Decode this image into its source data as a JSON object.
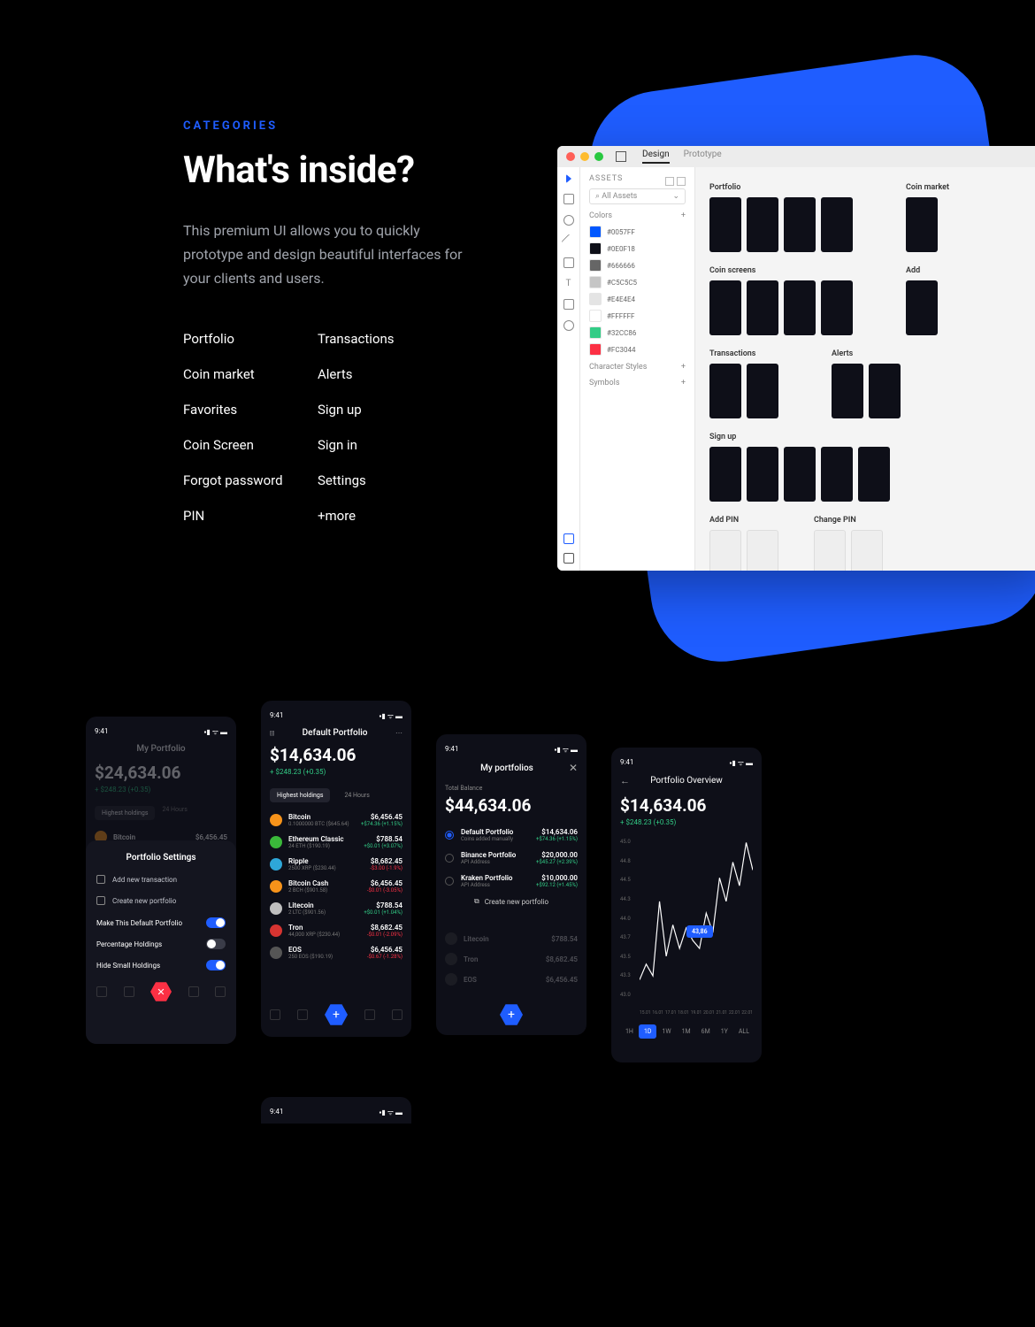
{
  "hero": {
    "eyebrow": "CATEGORIES",
    "headline": "What's inside?",
    "description": "This premium UI allows you to quickly prototype and design beautiful interfaces for your clients and users.",
    "categories_col1": [
      "Portfolio",
      "Coin market",
      "Favorites",
      "Coin Screen",
      "Forgot password",
      "PIN"
    ],
    "categories_col2": [
      "Transactions",
      "Alerts",
      "Sign up",
      "Sign in",
      "Settings",
      "+more"
    ]
  },
  "app": {
    "tabs": [
      "Design",
      "Prototype"
    ],
    "assets_label": "ASSETS",
    "search": "All Assets",
    "sections": {
      "colors": "Colors",
      "char_styles": "Character Styles",
      "symbols": "Symbols"
    },
    "swatches": [
      {
        "hex": "#0057FF"
      },
      {
        "hex": "#0E0F18"
      },
      {
        "hex": "#666666"
      },
      {
        "hex": "#C5C5C5"
      },
      {
        "hex": "#E4E4E4"
      },
      {
        "hex": "#FFFFFF"
      },
      {
        "hex": "#32CC86"
      },
      {
        "hex": "#FC3044"
      }
    ],
    "canvas_sections": [
      "Portfolio",
      "Coin market",
      "Coin screens",
      "Add",
      "Transactions",
      "Alerts",
      "Sign up",
      "Add PIN",
      "Change PIN"
    ]
  },
  "common": {
    "time": "9:41"
  },
  "phone1": {
    "title": "My Portfolio",
    "balance": "$24,634.06",
    "delta": "+ $248.23 (+0.35)",
    "tabs": [
      "Highest holdings",
      "24 Hours"
    ],
    "coin": "Bitcoin",
    "coin_val": "$6,456.45",
    "sheet": {
      "title": "Portfolio Settings",
      "add_tx": "Add new transaction",
      "create_pf": "Create new portfolio",
      "opt1": "Make This Default Portfolio",
      "opt2": "Percentage Holdings",
      "opt3": "Hide Small Holdings"
    }
  },
  "phone2": {
    "title": "Default Portfolio",
    "balance": "$14,634.06",
    "delta": "+ $248.23 (+0.35)",
    "tabs": [
      "Highest holdings",
      "24 Hours"
    ],
    "coins": [
      {
        "name": "Bitcoin",
        "sub": "0.1000000 BTC ($645.64)",
        "val": "$6,456.45",
        "chg": "+$74.36 (+1.15%)",
        "pos": true,
        "color": "#f7931a"
      },
      {
        "name": "Ethereum Classic",
        "sub": "24 ETH ($190.19)",
        "val": "$788.54",
        "chg": "+$0.01 (+3.07%)",
        "pos": true,
        "color": "#3ab83a"
      },
      {
        "name": "Ripple",
        "sub": "2500 XRP ($230.44)",
        "val": "$8,682.45",
        "chg": "-$3.00 (-1.9%)",
        "pos": false,
        "color": "#2ea7d8"
      },
      {
        "name": "Bitcoin Cash",
        "sub": "2 BCH ($901.58)",
        "val": "$6,456.45",
        "chg": "-$0.01 (-3.05%)",
        "pos": false,
        "color": "#f7931a"
      },
      {
        "name": "Litecoin",
        "sub": "2 LTC ($901.56)",
        "val": "$788.54",
        "chg": "+$0.01 (+1.04%)",
        "pos": true,
        "color": "#bfbfbf"
      },
      {
        "name": "Tron",
        "sub": "44,000 XRP ($230.44)",
        "val": "$8,682.45",
        "chg": "-$0.01 (-2.09%)",
        "pos": false,
        "color": "#d63431"
      },
      {
        "name": "EOS",
        "sub": "250 EOS ($190.19)",
        "val": "$6,456.45",
        "chg": "-$0.67 (-1.28%)",
        "pos": false,
        "color": "#555"
      }
    ]
  },
  "phone3": {
    "title": "My portfolios",
    "total_label": "Total Balance",
    "total": "$44,634.06",
    "portfolios": [
      {
        "name": "Default Portfolio",
        "sub": "Coins added manually",
        "val": "$14,634.06",
        "chg": "+$74.36 (+1.15%)",
        "on": true
      },
      {
        "name": "Binance Portfolio",
        "sub": "API Address",
        "val": "$20,000.00",
        "chg": "+$45.27 (+2.39%)",
        "on": false
      },
      {
        "name": "Kraken Portfolio",
        "sub": "API Address",
        "val": "$10,000.00",
        "chg": "+$92.12 (+1.45%)",
        "on": false
      }
    ],
    "create": "Create new portfolio",
    "faded": [
      {
        "name": "Litecoin",
        "val": "$788.54"
      },
      {
        "name": "Tron",
        "val": "$8,682.45"
      },
      {
        "name": "EOS",
        "val": "$6,456.45"
      }
    ]
  },
  "phone4": {
    "title": "Portfolio Overview",
    "balance": "$14,634.06",
    "delta": "+ $248.23 (+0.35)",
    "bubble": "43,86",
    "ranges": [
      "1H",
      "1D",
      "1W",
      "1M",
      "6M",
      "1Y",
      "ALL"
    ]
  },
  "chart_data": {
    "type": "line",
    "y_ticks": [
      45.0,
      44.8,
      44.5,
      44.3,
      44.0,
      43.7,
      43.5,
      43.3,
      43.0
    ],
    "x_ticks": [
      "15.01",
      "16.01",
      "17.01",
      "18.01",
      "19.01",
      "20.01",
      "21.01",
      "22.01",
      "22.01"
    ],
    "ylim": [
      43.0,
      45.0
    ],
    "highlight": {
      "x_index": 3,
      "value": 43.86
    },
    "values": [
      43.2,
      43.4,
      43.25,
      44.2,
      43.5,
      43.9,
      43.6,
      43.86,
      43.7,
      43.6,
      44.05,
      43.8,
      44.5,
      44.2,
      44.7,
      44.4,
      44.95,
      44.6
    ]
  }
}
